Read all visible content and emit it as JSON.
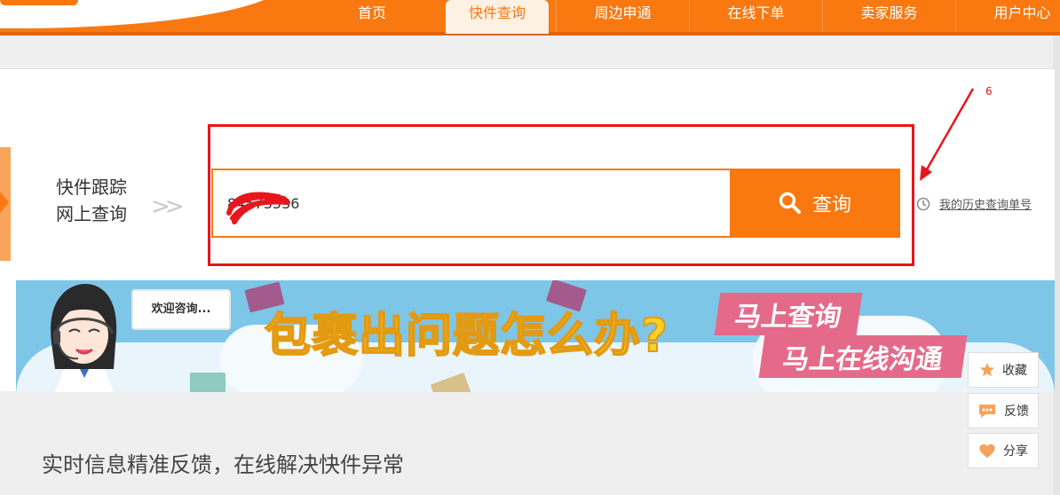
{
  "nav": {
    "items": [
      {
        "label": "首页",
        "active": false
      },
      {
        "label": "快件查询",
        "active": true
      },
      {
        "label": "周边申通",
        "active": false
      },
      {
        "label": "在线下单",
        "active": false
      },
      {
        "label": "卖家服务",
        "active": false
      },
      {
        "label": "用户中心",
        "active": false
      }
    ]
  },
  "tracker": {
    "label_line1": "快件跟踪",
    "label_line2": "网上查询",
    "chevron": ">>",
    "input_value": "84573536",
    "search_button": "查询",
    "history_link": "我的历史查询单号"
  },
  "annotation": {
    "number": "6",
    "color": "#e8161c"
  },
  "banner": {
    "bubble": "欢迎咨询...",
    "headline": "包裹出问题怎么办?",
    "tag1": "马上查询",
    "tag2": "马上在线沟通"
  },
  "float_bar": {
    "collect": "收藏",
    "feedback": "反馈",
    "share": "分享"
  },
  "tagline": "实时信息精准反馈，在线解决快件异常",
  "colors": {
    "brand_orange": "#f97810",
    "highlight_red": "#e8161c"
  }
}
